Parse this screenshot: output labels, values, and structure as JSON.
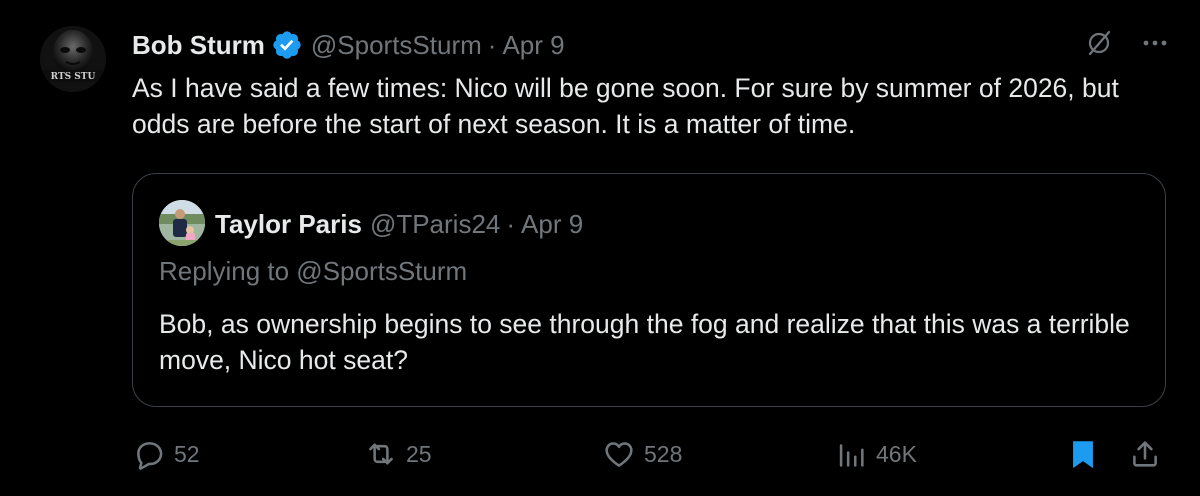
{
  "tweet": {
    "display_name": "Bob Sturm",
    "handle": "@SportsSturm",
    "separator": "·",
    "date": "Apr 9",
    "avatar_text": "RTS STU",
    "text": "As I have said a few times: Nico will be gone soon. For sure by summer of 2026, but odds are before the start of next season. It is a matter of time.",
    "verified_color": "#1d9bf0",
    "top_icons": [
      "grok-icon",
      "more-icon"
    ]
  },
  "quote": {
    "display_name": "Taylor Paris",
    "handle": "@TParis24",
    "separator": "·",
    "date": "Apr 9",
    "replying_to": "Replying to @SportsSturm",
    "text": "Bob, as ownership begins to see through the fog and realize that this was a terrible move, Nico hot seat?"
  },
  "actions": {
    "replies": "52",
    "reposts": "25",
    "likes": "528",
    "views": "46K",
    "bookmark_color": "#1d9bf0",
    "icons": [
      "reply-icon",
      "repost-icon",
      "like-icon",
      "views-icon",
      "bookmark-icon",
      "share-icon"
    ]
  },
  "colors": {
    "background": "#000000",
    "text_primary": "#e7e9ea",
    "text_secondary": "#71767b",
    "border": "#3b4046",
    "accent": "#1d9bf0"
  }
}
